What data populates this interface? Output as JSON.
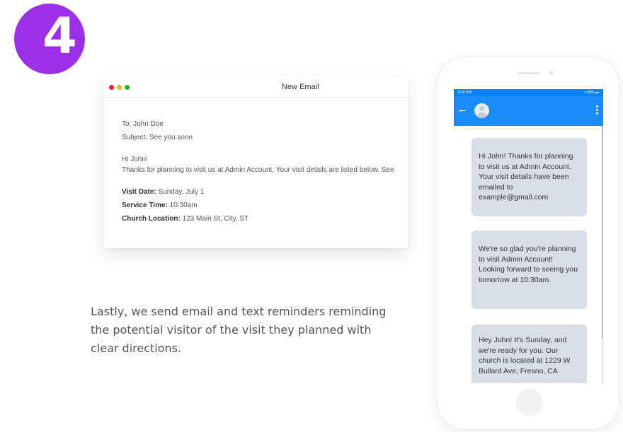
{
  "step": {
    "number": "4",
    "color": "#9b30e8"
  },
  "email": {
    "window_title": "New Email",
    "to": "To: John Doe",
    "subject": "Subject: See you soon",
    "greeting": "Hi John!",
    "body": "Thanks for planning to visit us at Admin Account. Your visit details are listed below. See",
    "visit_date_label": "Visit Date:",
    "visit_date_value": " Sunday, July 1",
    "service_time_label": "Service Time:",
    "service_time_value": " 10:30am",
    "location_label": "Church Location:",
    "location_value": " 123 Main St, City, ST"
  },
  "description": "Lastly, we send email and text reminders reminding the potential visitor of the visit they planned with clear directions.",
  "phone": {
    "status_time": "8:00 PM",
    "status_right": "▾ 85% ▬",
    "accent_color": "#1a8cf9",
    "messages": [
      "Hi John! Thanks for planning to visit us at Admin Account. Your visit details have been emailed to example@gmail.com",
      "We're so glad you're planning to visit Admin Account! Looking forward to seeing you tomorrow at 10:30am.",
      "Hey John! It's Sunday, and we're ready for you. Our church is located at 1229 W Bullard Ave, Fresno, CA"
    ]
  }
}
